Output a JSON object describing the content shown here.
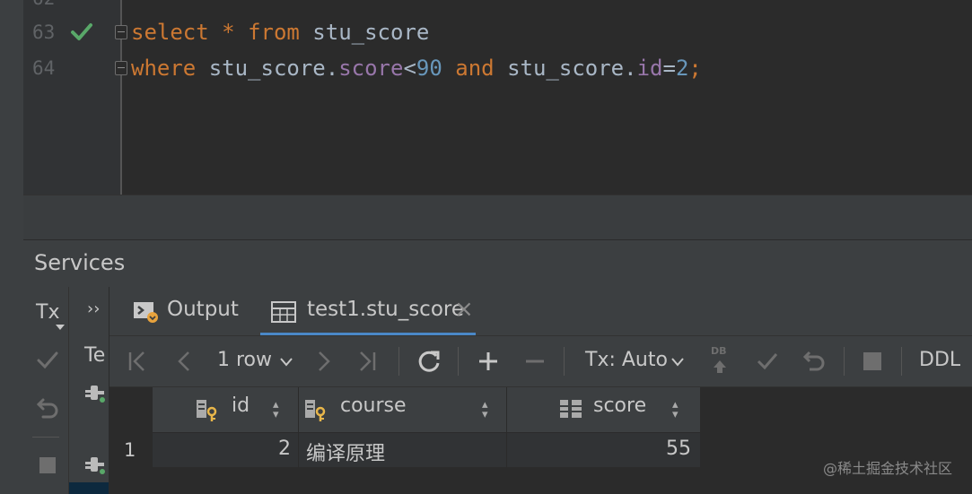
{
  "editor": {
    "line_top_partial": "62",
    "lines": [
      {
        "num": "63",
        "tokens": [
          {
            "t": "select",
            "c": "kw"
          },
          {
            "t": " ",
            "c": ""
          },
          {
            "t": "*",
            "c": "kw"
          },
          {
            "t": " ",
            "c": ""
          },
          {
            "t": "from",
            "c": "kw"
          },
          {
            "t": " stu_score",
            "c": ""
          }
        ]
      },
      {
        "num": "64",
        "tokens": [
          {
            "t": "where",
            "c": "kw"
          },
          {
            "t": " stu_score.",
            "c": ""
          },
          {
            "t": "score",
            "c": "fld"
          },
          {
            "t": "<",
            "c": ""
          },
          {
            "t": "90",
            "c": "num"
          },
          {
            "t": " ",
            "c": ""
          },
          {
            "t": "and",
            "c": "kw"
          },
          {
            "t": " stu_score.",
            "c": ""
          },
          {
            "t": "id",
            "c": "fld"
          },
          {
            "t": "=",
            "c": ""
          },
          {
            "t": "2",
            "c": "num"
          },
          {
            "t": ";",
            "c": "kw"
          }
        ]
      }
    ]
  },
  "services": {
    "title": "Services",
    "tx_label": "Tx",
    "more_label": "››",
    "tree_partial_label": "Te"
  },
  "tabs": [
    {
      "label": "Output",
      "icon": "console-icon",
      "active": false
    },
    {
      "label": "test1.stu_score",
      "icon": "table-icon",
      "active": true,
      "close": "×"
    }
  ],
  "toolbar": {
    "rows_label": "1 row",
    "tx_mode": "Tx: Auto",
    "ddl_label": "DDL",
    "db_badge": "DB"
  },
  "grid": {
    "columns": [
      {
        "name": "id",
        "icon": "key-column-icon"
      },
      {
        "name": "course",
        "icon": "key-column-icon"
      },
      {
        "name": "score",
        "icon": "column-icon"
      }
    ],
    "rows": [
      {
        "row_number": "1",
        "id": "2",
        "course": "编译原理",
        "score": "55"
      }
    ]
  },
  "watermark": "@稀土掘金技术社区",
  "colors": {
    "keyword": "#cc7832",
    "field": "#9876aa",
    "number": "#6897bb",
    "check": "#59a869",
    "accent": "#4a88c7",
    "key": "#e8b64a"
  }
}
